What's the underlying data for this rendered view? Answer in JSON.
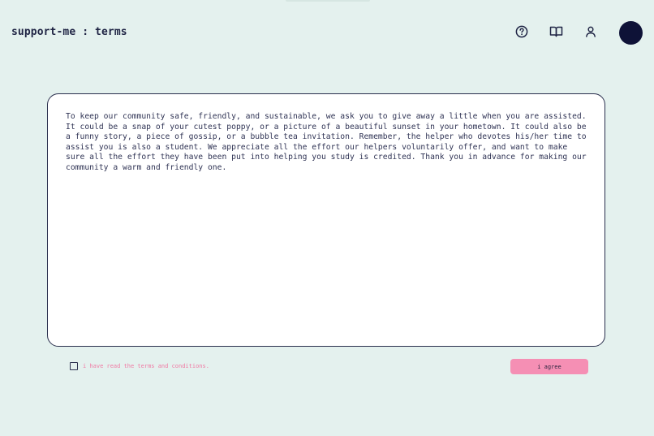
{
  "app": {
    "title": "support-me : terms"
  },
  "header": {
    "icons": [
      {
        "name": "help-icon"
      },
      {
        "name": "book-icon"
      },
      {
        "name": "user-icon"
      }
    ],
    "avatar_color": "#0e1237"
  },
  "terms": {
    "text": "To keep our community safe, friendly, and sustainable, we ask you to give away a little when you are assisted. It could be a snap of your cutest poppy, or a picture of a beautiful sunset in your hometown. It could also be a funny story, a piece of gossip, or a bubble tea invitation. Remember, the helper who devotes his/her time to assist you is also a student. We appreciate all the effort our helpers voluntarily offer, and want to make sure all the effort they have been put into helping you study is credited. Thank you in advance for making our community a warm and friendly one."
  },
  "agreement": {
    "checkbox_label": "i have read the terms and conditions.",
    "checked": false,
    "button_label": "i agree"
  },
  "colors": {
    "background": "#e4f1ee",
    "card_border": "#2a2f4d",
    "accent_pink": "#f58fb4",
    "label_pink": "#f07aa4",
    "text_dark": "#1f2444"
  }
}
